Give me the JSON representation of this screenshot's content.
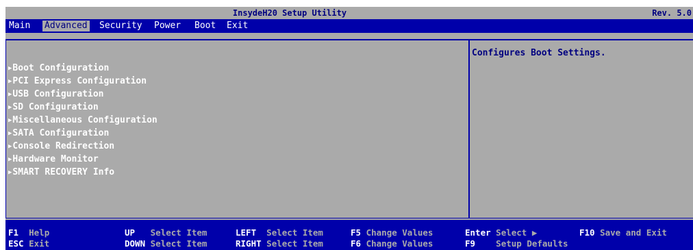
{
  "title_bar": {
    "title": "InsydeH20 Setup Utility",
    "revision": "Rev. 5.0"
  },
  "menu": {
    "items": [
      {
        "label": "Main"
      },
      {
        "label": "Advanced"
      },
      {
        "label": "Security"
      },
      {
        "label": "Power"
      },
      {
        "label": "Boot"
      },
      {
        "label": "Exit"
      }
    ],
    "active": "Advanced"
  },
  "submenu": {
    "arrow_glyph": "▶",
    "items": [
      {
        "label": "Boot Configuration"
      },
      {
        "label": "PCI Express Configuration"
      },
      {
        "label": "USB Configuration"
      },
      {
        "label": "SD Configuration"
      },
      {
        "label": "Miscellaneous Configuration"
      },
      {
        "label": "SATA Configuration"
      },
      {
        "label": "Console Redirection"
      },
      {
        "label": "Hardware Monitor"
      },
      {
        "label": "SMART RECOVERY Info"
      }
    ]
  },
  "help": {
    "text": "Configures Boot Settings."
  },
  "footer": {
    "keys": [
      {
        "key": "F1",
        "desc": "Help"
      },
      {
        "key": "ESC",
        "desc": "Exit"
      },
      {
        "key": "UP",
        "desc": "Select Item"
      },
      {
        "key": "DOWN",
        "desc": "Select Item"
      },
      {
        "key": "LEFT",
        "desc": "Select Item"
      },
      {
        "key": "RIGHT",
        "desc": "Select Item"
      },
      {
        "key": "F5",
        "desc": "Change Values"
      },
      {
        "key": "F6",
        "desc": "Change Values"
      },
      {
        "key": "Enter",
        "desc": "Select ▶"
      },
      {
        "key": "F9",
        "desc": "Setup Defaults"
      },
      {
        "key": "F10",
        "desc": "Save and Exit"
      }
    ]
  },
  "colors": {
    "bios_blue": "#0000aa",
    "bios_gray": "#aaaaaa",
    "text_white": "#ffffff",
    "text_navy": "#000080"
  }
}
